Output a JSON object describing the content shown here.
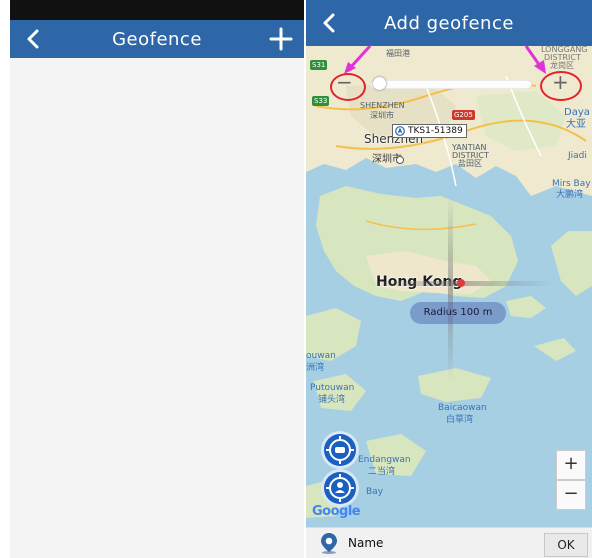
{
  "left_screen": {
    "header": {
      "title": "Geofence"
    }
  },
  "right_screen": {
    "header": {
      "title": "Add geofence"
    },
    "map": {
      "device_label": "TKS1-51389",
      "radius_label": "Radius  100 m",
      "city_main": "Hong Kong",
      "city_shenzhen": "Shenzhen",
      "shenzhen_zh": "深圳市",
      "labels": {
        "top_zh": "福田港",
        "shenzhen_caps": "SHENZHEN",
        "shenzhen_caps_zh": "深圳市",
        "yantian": "YANTIAN",
        "yantian_district": "DISTRICT",
        "yantian_zh": "盐田区",
        "dayabay": "Daya",
        "dayabay_zh": "大亚",
        "jiadi": "Jiadi",
        "mirs_bay": "Mirs Bay",
        "mirs_bay_zh": "大鹏湾",
        "longgang": "LONGGANG",
        "longgang_district": "DISTRICT",
        "longgang_zh": "龙岗区",
        "touwan": "ouwan",
        "touwan_zh": "洲湾",
        "putouwan": "Putouwan",
        "putouwan_zh": "铺头湾",
        "baicaowan": "Baicaowan",
        "baicaowan_zh": "白草湾",
        "endangwan": "Endangwan",
        "endangwan_zh": "二当湾",
        "bay": "Bay",
        "road_s31": "S31",
        "road_s33": "S33",
        "road_g205": "G205"
      },
      "attribution": "Google",
      "zoom_in": "+",
      "zoom_out": "−",
      "slider_minus": "−",
      "slider_plus": "+",
      "slider_level": 0.02
    },
    "footer": {
      "name_label": "Name",
      "ok_label": "OK"
    },
    "colors": {
      "accent": "#2e67a8",
      "annotation_red": "#e0262b",
      "annotation_magenta": "#e331d8",
      "water": "#a6cfe3",
      "land": "#efe9cf"
    }
  }
}
